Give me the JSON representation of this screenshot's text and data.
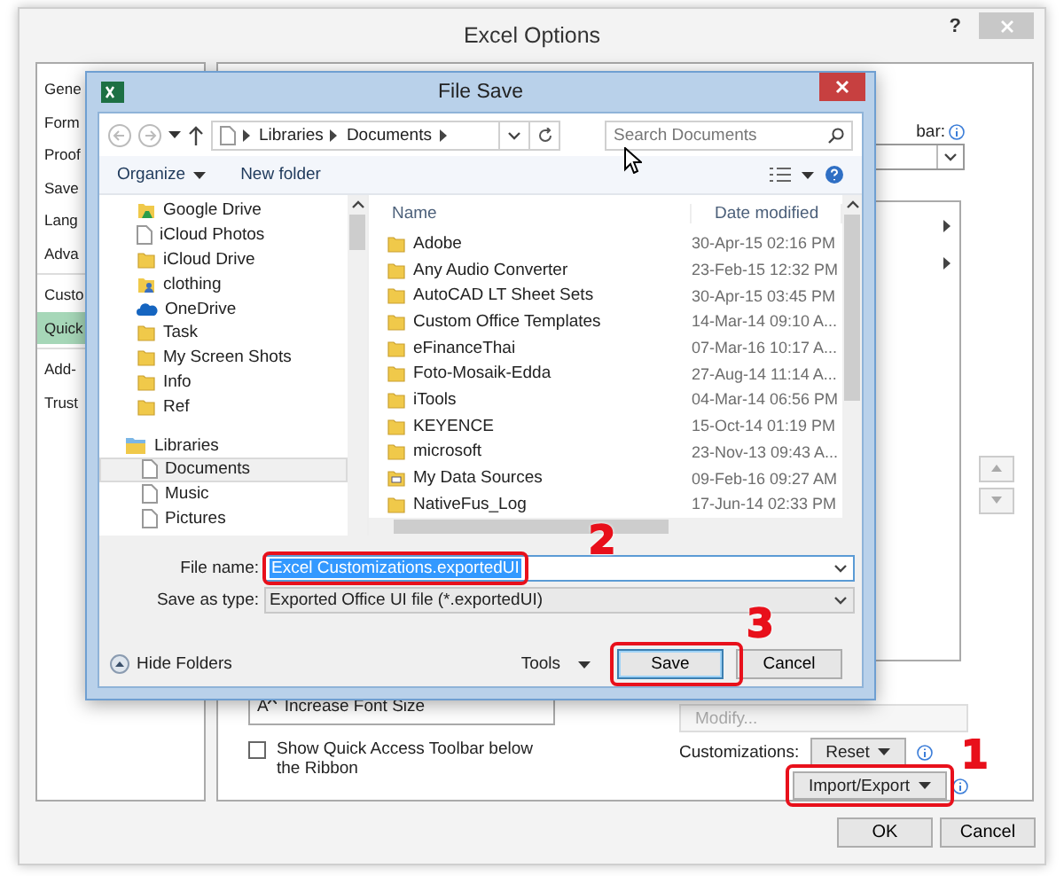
{
  "window": {
    "title": "Excel Options",
    "help": "?"
  },
  "sidebar": {
    "items": [
      {
        "label": "Gene",
        "selected": false,
        "divider_before": false
      },
      {
        "label": "Form",
        "selected": false,
        "divider_before": false
      },
      {
        "label": "Proof",
        "selected": false,
        "divider_before": false
      },
      {
        "label": "Save",
        "selected": false,
        "divider_before": false
      },
      {
        "label": "Lang",
        "selected": false,
        "divider_before": false
      },
      {
        "label": "Adva",
        "selected": false,
        "divider_before": false
      },
      {
        "label": "Custo",
        "selected": false,
        "divider_before": true
      },
      {
        "label": "Quick",
        "selected": true,
        "divider_before": false
      },
      {
        "label": "Add-",
        "selected": false,
        "divider_before": true
      },
      {
        "label": "Trust",
        "selected": false,
        "divider_before": false
      }
    ]
  },
  "options_panel": {
    "toolbar_label": "bar:",
    "command_icon_letter": "A",
    "command_item": "Increase Font Size",
    "checkbox": {
      "label": "Show Quick Access Toolbar below the Ribbon",
      "checked": false
    },
    "modify_button": {
      "label": "Modify...",
      "disabled": true
    },
    "customizations_label": "Customizations:",
    "reset_button": "Reset",
    "import_export_button": "Import/Export"
  },
  "footer_buttons": [
    "OK",
    "Cancel"
  ],
  "dialog": {
    "title": "File Save",
    "breadcrumb": [
      "Libraries",
      "Documents"
    ],
    "search": {
      "placeholder": "Search Documents"
    },
    "commands": [
      "Organize",
      "New folder"
    ],
    "nav_pane": {
      "items": [
        {
          "label": "Google Drive",
          "kind": "drive"
        },
        {
          "label": "iCloud Photos",
          "kind": "file"
        },
        {
          "label": "iCloud Drive",
          "kind": "folder"
        },
        {
          "label": "clothing",
          "kind": "user"
        },
        {
          "label": "OneDrive",
          "kind": "cloud"
        },
        {
          "label": "Task",
          "kind": "folder"
        },
        {
          "label": "My Screen Shots",
          "kind": "folder"
        },
        {
          "label": "Info",
          "kind": "folder"
        },
        {
          "label": "Ref",
          "kind": "folder"
        }
      ],
      "libraries": {
        "label": "Libraries",
        "children": [
          {
            "label": "Documents",
            "selected": true
          },
          {
            "label": "Music",
            "selected": false
          },
          {
            "label": "Pictures",
            "selected": false
          }
        ]
      }
    },
    "columns": [
      "Name",
      "Date modified"
    ],
    "files": [
      {
        "name": "Adobe",
        "date": "30-Apr-15 02:16 PM",
        "kind": "folder"
      },
      {
        "name": "Any Audio Converter",
        "date": "23-Feb-15 12:32 PM",
        "kind": "folder"
      },
      {
        "name": "AutoCAD LT Sheet Sets",
        "date": "30-Apr-15 03:45 PM",
        "kind": "folder"
      },
      {
        "name": "Custom Office Templates",
        "date": "14-Mar-14 09:10 A...",
        "kind": "folder"
      },
      {
        "name": "eFinanceThai",
        "date": "07-Mar-16 10:17 A...",
        "kind": "folder"
      },
      {
        "name": "Foto-Mosaik-Edda",
        "date": "27-Aug-14 11:14 A...",
        "kind": "folder"
      },
      {
        "name": "iTools",
        "date": "04-Mar-14 06:56 PM",
        "kind": "folder"
      },
      {
        "name": "KEYENCE",
        "date": "15-Oct-14 01:19 PM",
        "kind": "folder"
      },
      {
        "name": "microsoft",
        "date": "23-Nov-13 09:43 A...",
        "kind": "folder"
      },
      {
        "name": "My Data Sources",
        "date": "09-Feb-16 09:27 AM",
        "kind": "data-folder"
      },
      {
        "name": "NativeFus_Log",
        "date": "17-Jun-14 02:33 PM",
        "kind": "folder"
      }
    ],
    "file_name": {
      "label": "File name:",
      "value": "Excel Customizations.exportedUI"
    },
    "save_type": {
      "label": "Save as type:",
      "value": "Exported Office UI file (*.exportedUI)"
    },
    "hide_folders": "Hide Folders",
    "tools": "Tools",
    "buttons": [
      "Save",
      "Cancel"
    ]
  },
  "annotations": [
    {
      "number": "2",
      "kind": "file-name"
    },
    {
      "number": "3",
      "kind": "save"
    },
    {
      "number": "1",
      "kind": "import-export"
    }
  ]
}
